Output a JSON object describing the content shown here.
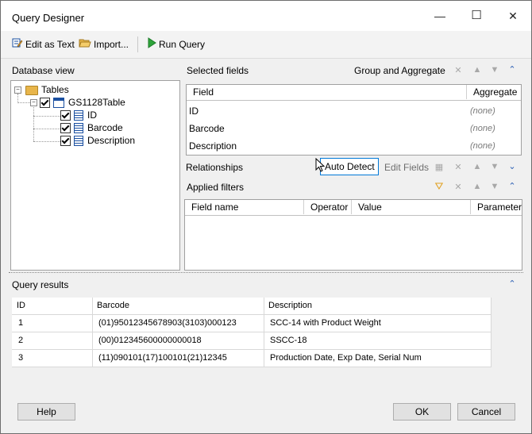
{
  "window": {
    "title": "Query Designer",
    "minimize": "—",
    "maximize": "☐",
    "close": "✕"
  },
  "toolbar": {
    "edit_as_text": "Edit as Text",
    "import": "Import...",
    "run_query": "Run Query"
  },
  "database_view": {
    "header": "Database view",
    "root": "Tables",
    "table": "GS1128Table",
    "columns": [
      "ID",
      "Barcode",
      "Description"
    ]
  },
  "selected_fields": {
    "header": "Selected fields",
    "group_and_aggregate": "Group and Aggregate",
    "col_field": "Field",
    "col_aggregate": "Aggregate",
    "rows": [
      {
        "field": "ID",
        "aggregate": "(none)"
      },
      {
        "field": "Barcode",
        "aggregate": "(none)"
      },
      {
        "field": "Description",
        "aggregate": "(none)"
      }
    ]
  },
  "relationships": {
    "header": "Relationships",
    "auto_detect": "Auto Detect",
    "edit_fields": "Edit Fields"
  },
  "applied_filters": {
    "header": "Applied filters",
    "columns": [
      "Field name",
      "Operator",
      "Value",
      "Parameter"
    ]
  },
  "query_results": {
    "header": "Query results",
    "columns": [
      "ID",
      "Barcode",
      "Description"
    ],
    "rows": [
      {
        "id": "1",
        "barcode": "(01)95012345678903(3103)000123",
        "description": "SCC-14 with Product Weight"
      },
      {
        "id": "2",
        "barcode": "(00)012345600000000018",
        "description": "SSCC-18"
      },
      {
        "id": "3",
        "barcode": "(11)090101(17)100101(21)12345",
        "description": "Production Date, Exp Date, Serial Num"
      }
    ]
  },
  "buttons": {
    "help": "Help",
    "ok": "OK",
    "cancel": "Cancel"
  },
  "colors": {
    "accent_blue": "#2b5fb4",
    "run_green": "#2ea43a",
    "folder": "#e8b54a"
  }
}
